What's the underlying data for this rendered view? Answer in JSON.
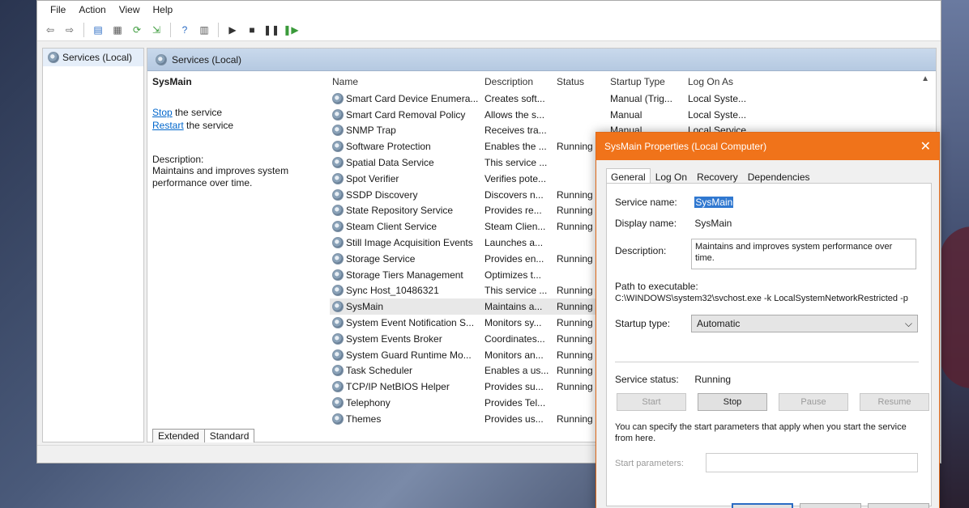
{
  "menu": {
    "items": [
      "File",
      "Action",
      "View",
      "Help"
    ]
  },
  "tree": {
    "root_label": "Services (Local)"
  },
  "content": {
    "header": "Services (Local)",
    "detail": {
      "title": "SysMain",
      "stop_link": "Stop",
      "stop_suffix": " the service",
      "restart_link": "Restart",
      "restart_suffix": " the service",
      "description_label": "Description:",
      "description_text": "Maintains and improves system performance over time."
    },
    "columns": {
      "name": "Name",
      "description": "Description",
      "status": "Status",
      "startup": "Startup Type",
      "logon": "Log On As"
    },
    "rows": [
      {
        "name": "Smart Card Device Enumera...",
        "description": "Creates soft...",
        "status": "",
        "startup": "Manual (Trig...",
        "logon": "Local Syste..."
      },
      {
        "name": "Smart Card Removal Policy",
        "description": "Allows the s...",
        "status": "",
        "startup": "Manual",
        "logon": "Local Syste..."
      },
      {
        "name": "SNMP Trap",
        "description": "Receives tra...",
        "status": "",
        "startup": "Manual",
        "logon": "Local Service"
      },
      {
        "name": "Software Protection",
        "description": "Enables the ...",
        "status": "Running",
        "startup": "",
        "logon": ""
      },
      {
        "name": "Spatial Data Service",
        "description": "This service ...",
        "status": "",
        "startup": "",
        "logon": ""
      },
      {
        "name": "Spot Verifier",
        "description": "Verifies pote...",
        "status": "",
        "startup": "",
        "logon": ""
      },
      {
        "name": "SSDP Discovery",
        "description": "Discovers n...",
        "status": "Running",
        "startup": "",
        "logon": ""
      },
      {
        "name": "State Repository Service",
        "description": "Provides re...",
        "status": "Running",
        "startup": "",
        "logon": ""
      },
      {
        "name": "Steam Client Service",
        "description": "Steam Clien...",
        "status": "Running",
        "startup": "",
        "logon": ""
      },
      {
        "name": "Still Image Acquisition Events",
        "description": "Launches a...",
        "status": "",
        "startup": "",
        "logon": ""
      },
      {
        "name": "Storage Service",
        "description": "Provides en...",
        "status": "Running",
        "startup": "",
        "logon": ""
      },
      {
        "name": "Storage Tiers Management",
        "description": "Optimizes t...",
        "status": "",
        "startup": "",
        "logon": ""
      },
      {
        "name": "Sync Host_10486321",
        "description": "This service ...",
        "status": "Running",
        "startup": "",
        "logon": ""
      },
      {
        "name": "SysMain",
        "description": "Maintains a...",
        "status": "Running",
        "startup": "",
        "logon": ""
      },
      {
        "name": "System Event Notification S...",
        "description": "Monitors sy...",
        "status": "Running",
        "startup": "",
        "logon": ""
      },
      {
        "name": "System Events Broker",
        "description": "Coordinates...",
        "status": "Running",
        "startup": "",
        "logon": ""
      },
      {
        "name": "System Guard Runtime Mo...",
        "description": "Monitors an...",
        "status": "Running",
        "startup": "",
        "logon": ""
      },
      {
        "name": "Task Scheduler",
        "description": "Enables a us...",
        "status": "Running",
        "startup": "",
        "logon": ""
      },
      {
        "name": "TCP/IP NetBIOS Helper",
        "description": "Provides su...",
        "status": "Running",
        "startup": "",
        "logon": ""
      },
      {
        "name": "Telephony",
        "description": "Provides Tel...",
        "status": "",
        "startup": "",
        "logon": ""
      },
      {
        "name": "Themes",
        "description": "Provides us...",
        "status": "Running",
        "startup": "",
        "logon": ""
      }
    ],
    "tabs": [
      "Extended",
      "Standard"
    ]
  },
  "dialog": {
    "title": "SysMain Properties (Local Computer)",
    "tabs": [
      "General",
      "Log On",
      "Recovery",
      "Dependencies"
    ],
    "service_name_label": "Service name:",
    "service_name": "SysMain",
    "display_name_label": "Display name:",
    "display_name": "SysMain",
    "description_label": "Description:",
    "description": "Maintains and improves system performance over time.",
    "path_label": "Path to executable:",
    "path": "C:\\WINDOWS\\system32\\svchost.exe -k LocalSystemNetworkRestricted -p",
    "startup_type_label": "Startup type:",
    "startup_type": "Automatic",
    "service_status_label": "Service status:",
    "service_status": "Running",
    "buttons": {
      "start": "Start",
      "stop": "Stop",
      "pause": "Pause",
      "resume": "Resume"
    },
    "note": "You can specify the start parameters that apply when you start the service from here.",
    "start_params_label": "Start parameters:"
  },
  "colors": {
    "dialog_accent": "#f0731a",
    "selection": "#3078d0",
    "link": "#0066cc"
  }
}
